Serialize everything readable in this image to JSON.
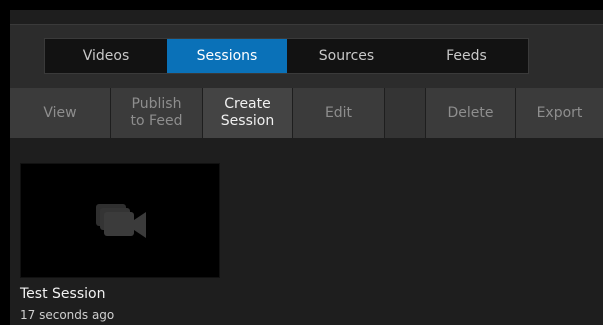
{
  "nav": {
    "tabs": [
      {
        "label": "Videos",
        "active": false
      },
      {
        "label": "Sessions",
        "active": true
      },
      {
        "label": "Sources",
        "active": false
      },
      {
        "label": "Feeds",
        "active": false
      }
    ]
  },
  "toolbar": {
    "view": "View",
    "publish": "Publish\nto Feed",
    "create": "Create\nSession",
    "edit": "Edit",
    "delete": "Delete",
    "export": "Export"
  },
  "sessions": [
    {
      "title": "Test Session",
      "time": "17 seconds ago",
      "icon": "camera-stack-icon"
    }
  ],
  "colors": {
    "accent": "#0a71b8",
    "background": "#1e1e1e",
    "button": "#3b3b3b"
  }
}
